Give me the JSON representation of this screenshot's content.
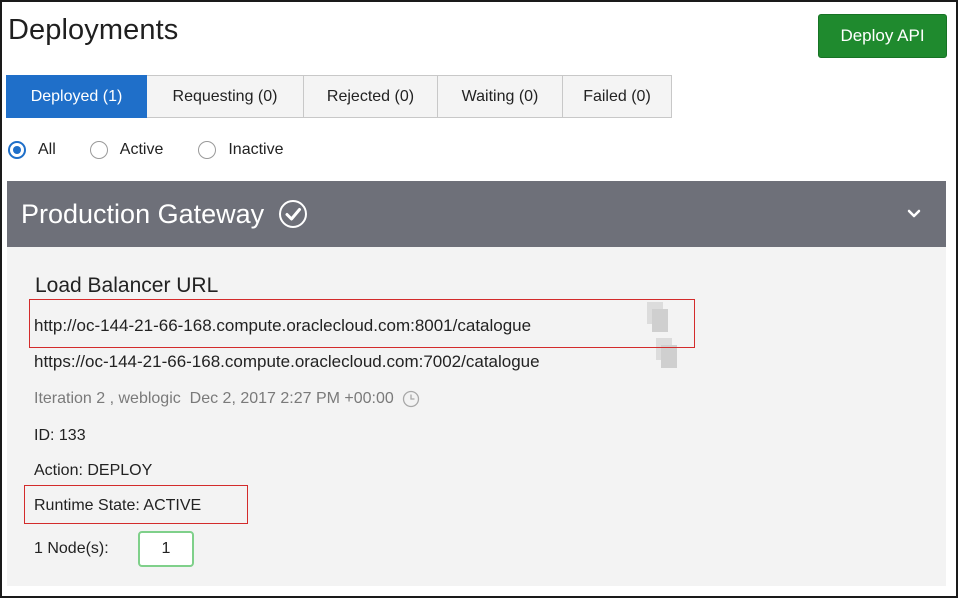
{
  "header": {
    "title": "Deployments",
    "deploy_button": "Deploy API"
  },
  "tabs": [
    {
      "label": "Deployed (1)",
      "active": true
    },
    {
      "label": "Requesting (0)",
      "active": false
    },
    {
      "label": "Rejected (0)",
      "active": false
    },
    {
      "label": "Waiting (0)",
      "active": false
    },
    {
      "label": "Failed (0)",
      "active": false
    }
  ],
  "filters": [
    {
      "label": "All",
      "selected": true
    },
    {
      "label": "Active",
      "selected": false
    },
    {
      "label": "Inactive",
      "selected": false
    }
  ],
  "gateway": {
    "name": "Production Gateway",
    "status_icon": "check-circle-icon",
    "expand_icon": "chevron-down-icon",
    "section_title": "Load Balancer URL",
    "urls": [
      "http://oc-144-21-66-168.compute.oraclecloud.com:8001/catalogue",
      "https://oc-144-21-66-168.compute.oraclecloud.com:7002/catalogue"
    ],
    "meta": "Iteration 2 , weblogic  Dec 2, 2017 2:27 PM +00:00",
    "id": "ID: 133",
    "action": "Action: DEPLOY",
    "runtime_state": "Runtime State: ACTIVE",
    "nodes_label": "1 Node(s):",
    "nodes_value": "1"
  },
  "colors": {
    "accent": "#1f6fc9",
    "deploy_button": "#1f8a2e",
    "gateway_header": "#6e7079",
    "highlight": "#d32b2b",
    "nodes_border": "#7fd08a"
  }
}
